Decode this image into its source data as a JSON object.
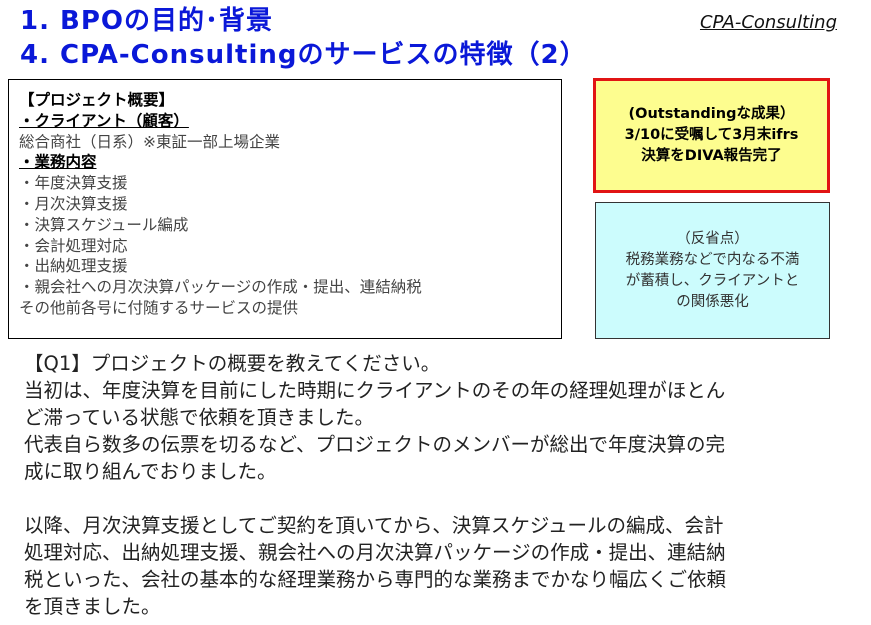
{
  "header": {
    "title_line1": "1. BPOの目的･背景",
    "title_line2": "4. CPA-Consultingのサービスの特徴（2）",
    "brand": "CPA-Consulting"
  },
  "overview": {
    "heading": "【プロジェクト概要】",
    "client_label": "・クライアント（顧客）",
    "client_value": "総合商社（日系）※東証一部上場企業",
    "business_label": "・業務内容",
    "items": [
      "・年度決算支援",
      "・月次決算支援",
      "・決算スケジュール編成",
      "・会計処理対応",
      "・出納処理支援",
      "・親会社への月次決算パッケージの作成・提出、連結納税",
      "その他前各号に付随するサービスの提供"
    ]
  },
  "outstanding": {
    "lines": [
      "(Outstandingな成果）",
      "3/10に受嘱して3月末ifrs",
      "決算をDIVA報告完了"
    ]
  },
  "reflection": {
    "lines": [
      "（反省点）",
      "税務業務などで内なる不満",
      "が蓄積し、クライアントと",
      "の関係悪化"
    ]
  },
  "qa": {
    "question": "【Q1】プロジェクトの概要を教えてください。",
    "para1": [
      "当初は、年度決算を目前にした時期にクライアントのその年の経理処理がほとん",
      "ど滞っている状態で依頼を頂きました。",
      "代表自ら数多の伝票を切るなど、プロジェクトのメンバーが総出で年度決算の完",
      "成に取り組んでおりました。"
    ],
    "para2": [
      "以降、月次決算支援としてご契約を頂いてから、決算スケジュールの編成、会計",
      "処理対応、出納処理支援、親会社への月次決算パッケージの作成・提出、連結納",
      "税といった、会社の基本的な経理業務から専門的な業務までかなり幅広くご依頼",
      "を頂きました。"
    ]
  },
  "colors": {
    "title": "#0a18d8",
    "outstanding_bg": "#fdfd8f",
    "outstanding_border": "#e11414",
    "reflection_bg": "#ccfcfd"
  }
}
